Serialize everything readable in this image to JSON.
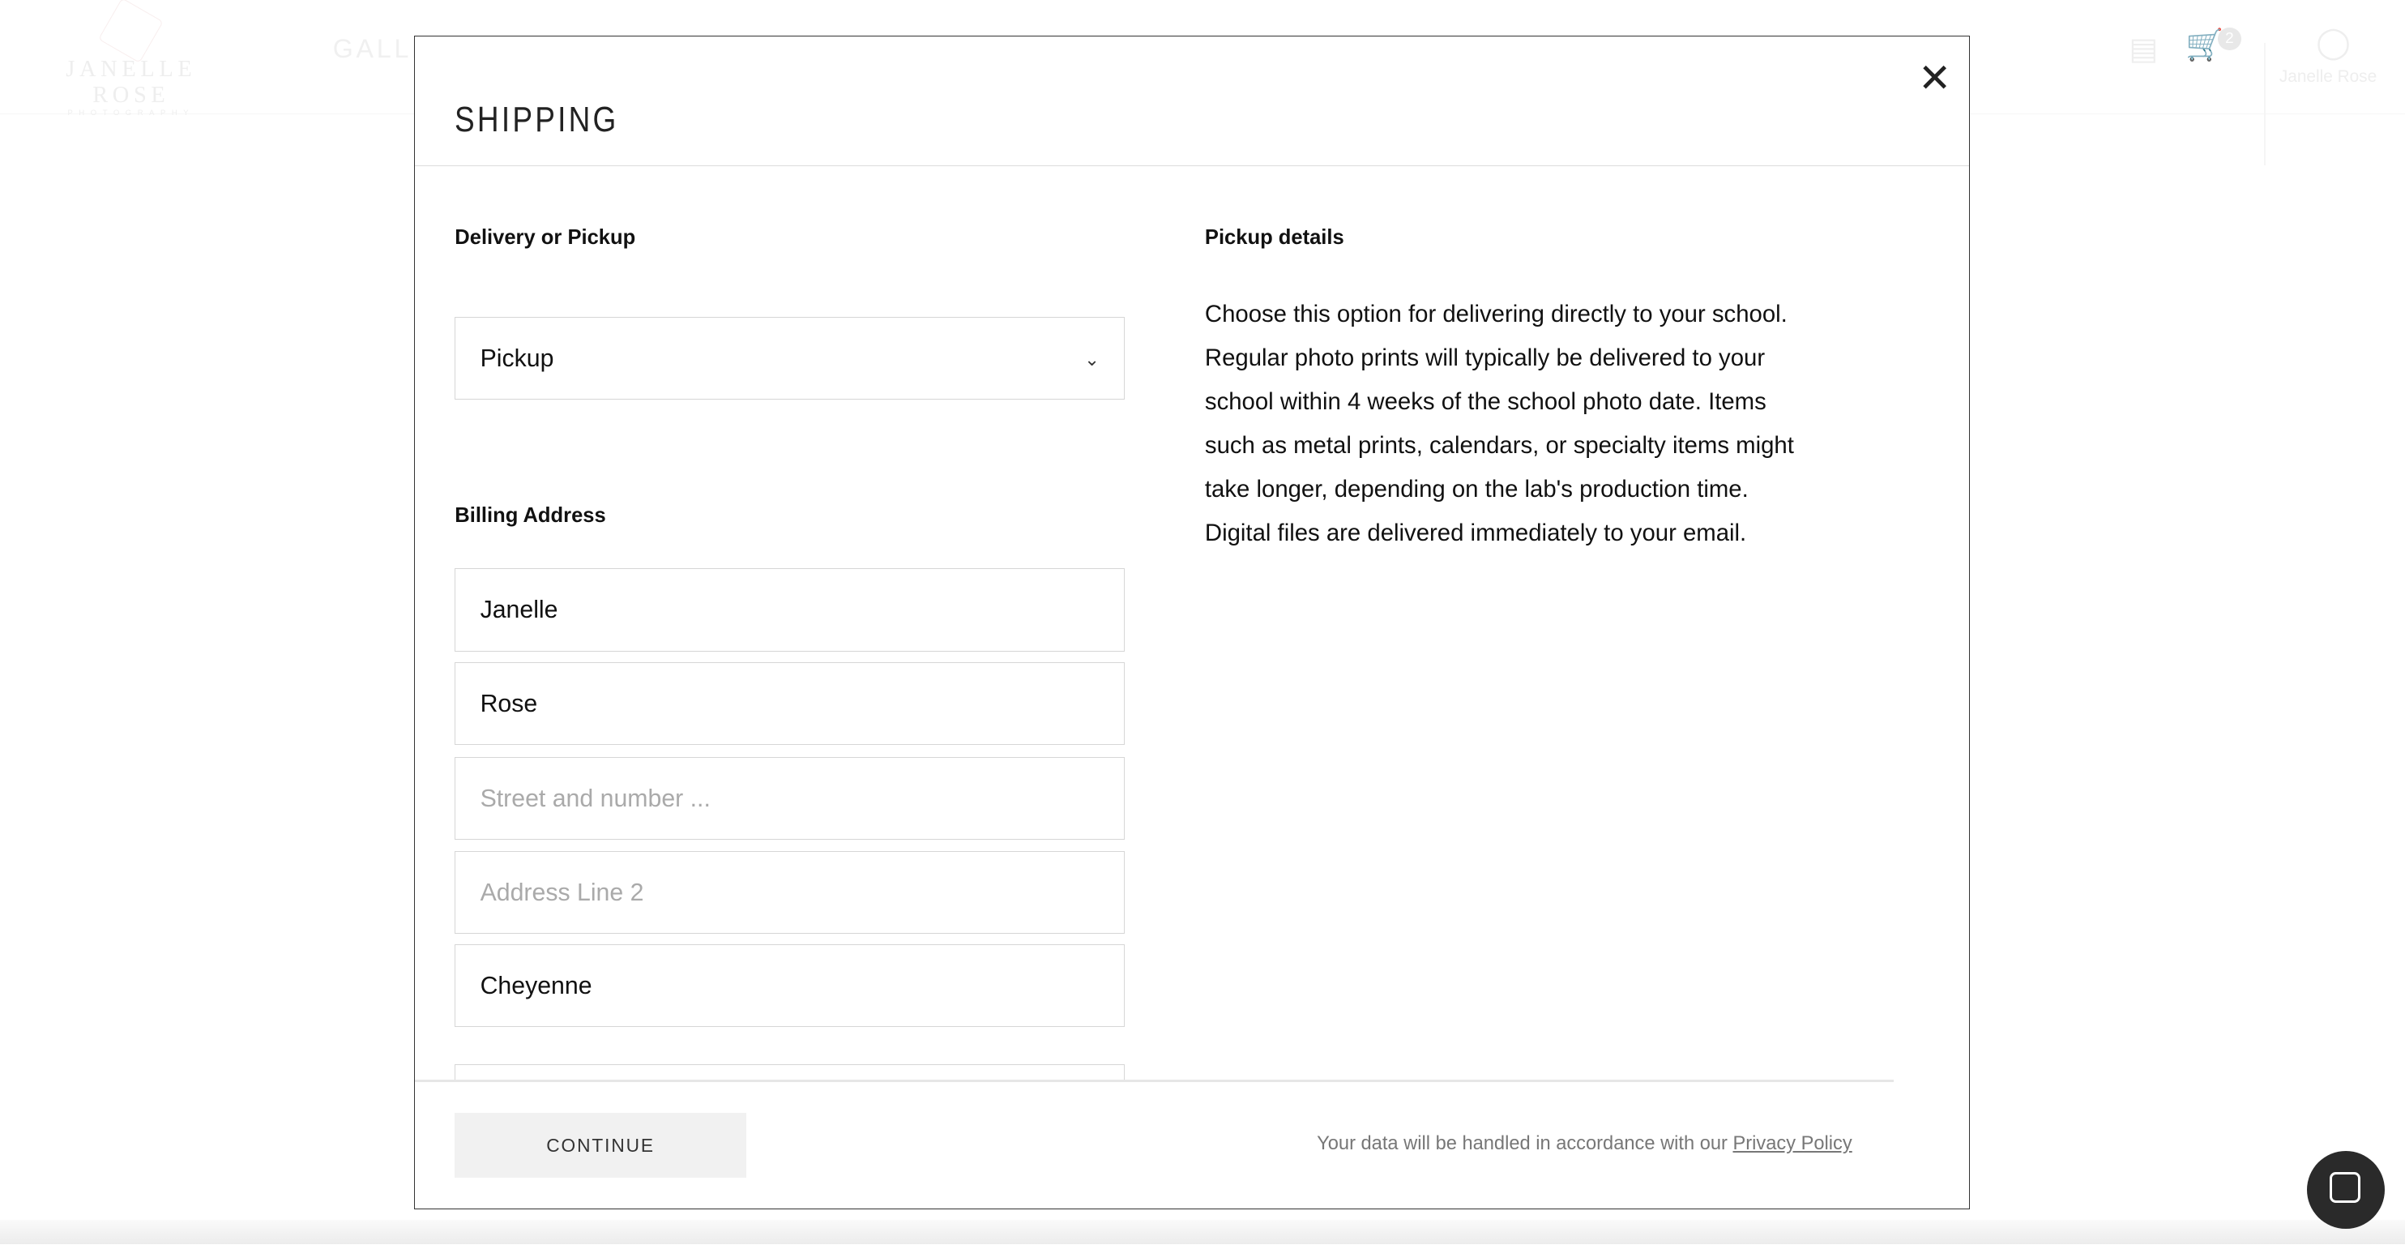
{
  "header": {
    "logo_name": "JANELLE ROSE",
    "logo_sub": "PHOTOGRAPHY",
    "nav_partial": "GALLE",
    "cart_count": "2",
    "user_name": "Janelle Rose"
  },
  "modal": {
    "title": "SHIPPING",
    "close_icon": "close-icon",
    "delivery_label": "Delivery or Pickup",
    "delivery_value": "Pickup",
    "billing_label": "Billing Address",
    "fields": [
      {
        "value": "Janelle",
        "placeholder": ""
      },
      {
        "value": "Rose",
        "placeholder": ""
      },
      {
        "value": "",
        "placeholder": "Street and number ..."
      },
      {
        "value": "",
        "placeholder": "Address Line 2"
      },
      {
        "value": "Cheyenne",
        "placeholder": ""
      }
    ],
    "pickup_title": "Pickup details",
    "pickup_lines": [
      "Choose this option for delivering directly to your school.",
      "Regular photo prints will typically be delivered to your",
      "school within 4 weeks of the school photo date. Items",
      "such as metal prints, calendars, or specialty items might",
      "take longer, depending on the lab's production time.",
      "Digital files are delivered immediately to your email."
    ],
    "continue_label": "CONTINUE",
    "privacy_text": "Your data will be handled in accordance with our ",
    "privacy_link": "Privacy Policy"
  }
}
